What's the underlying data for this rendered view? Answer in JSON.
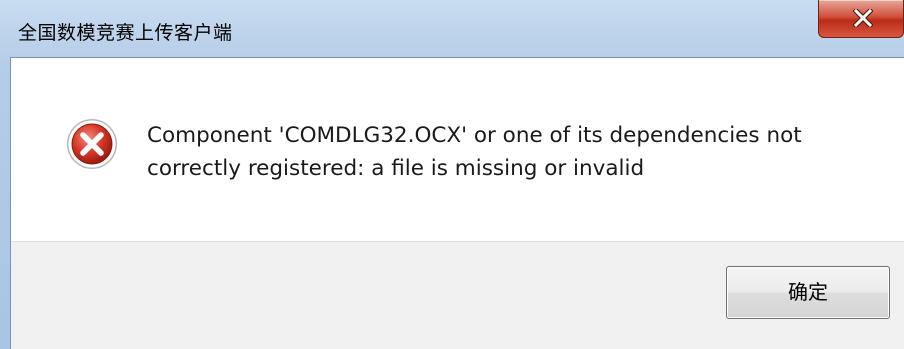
{
  "window": {
    "title": "全国数模竞赛上传客户端",
    "close_icon": "close-icon",
    "colors": {
      "frame": "#b5cde8",
      "close_button": "#c8412a",
      "footer": "#f0f0f0"
    }
  },
  "dialog": {
    "icon": "error-icon",
    "message_line1": "Component 'COMDLG32.OCX' or one of its dependencies not",
    "message_line2": "correctly registered: a file is missing or invalid",
    "ok_label": "确定"
  }
}
